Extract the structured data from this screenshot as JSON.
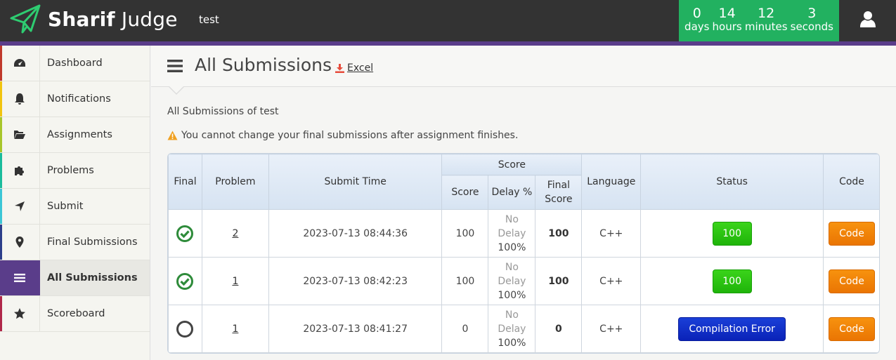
{
  "app": {
    "logo_bold": "Sharif",
    "logo_light": " Judge",
    "username": "test",
    "accent_color": "#5a3d8a",
    "countdown_color": "#22b160"
  },
  "countdown": [
    {
      "num": "0",
      "unit": "days"
    },
    {
      "num": "14",
      "unit": "hours"
    },
    {
      "num": "12",
      "unit": "minutes"
    },
    {
      "num": "3",
      "unit": "seconds"
    }
  ],
  "sidebar": {
    "items": [
      {
        "label": "Dashboard",
        "icon": "dashboard-icon",
        "color": "#c0392b"
      },
      {
        "label": "Notifications",
        "icon": "bell-icon",
        "color": "#f1c40f"
      },
      {
        "label": "Assignments",
        "icon": "folder-open-icon",
        "color": "#a8c62b"
      },
      {
        "label": "Problems",
        "icon": "puzzle-icon",
        "color": "#1abc9c"
      },
      {
        "label": "Submit",
        "icon": "location-arrow-icon",
        "color": "#3cc6d6"
      },
      {
        "label": "Final Submissions",
        "icon": "map-marker-icon",
        "color": "#2c3e8a"
      },
      {
        "label": "All Submissions",
        "icon": "list-icon",
        "color": "#5a3d8a"
      },
      {
        "label": "Scoreboard",
        "icon": "star-icon",
        "color": "#b0284a"
      }
    ]
  },
  "main": {
    "title": "All Submissions",
    "excel_label": "Excel",
    "subtitle": "All Submissions of test",
    "warning": "You cannot change your final submissions after assignment finishes."
  },
  "table": {
    "headers": {
      "final": "Final",
      "problem": "Problem",
      "submit_time": "Submit Time",
      "score_group": "Score",
      "score": "Score",
      "delay": "Delay %",
      "final_score": "Final Score",
      "language": "Language",
      "status": "Status",
      "code": "Code"
    },
    "rows": [
      {
        "final": true,
        "problem": "2",
        "submit_time": "2023-07-13 08:44:36",
        "score": "100",
        "delay_text": "No Delay",
        "delay_pct": "100%",
        "final_score": "100",
        "language": "C++",
        "status": "100",
        "status_type": "green",
        "code": "Code"
      },
      {
        "final": true,
        "problem": "1",
        "submit_time": "2023-07-13 08:42:23",
        "score": "100",
        "delay_text": "No Delay",
        "delay_pct": "100%",
        "final_score": "100",
        "language": "C++",
        "status": "100",
        "status_type": "green",
        "code": "Code"
      },
      {
        "final": false,
        "problem": "1",
        "submit_time": "2023-07-13 08:41:27",
        "score": "0",
        "delay_text": "No Delay",
        "delay_pct": "100%",
        "final_score": "0",
        "language": "C++",
        "status": "Compilation Error",
        "status_type": "blue",
        "code": "Code"
      }
    ]
  }
}
